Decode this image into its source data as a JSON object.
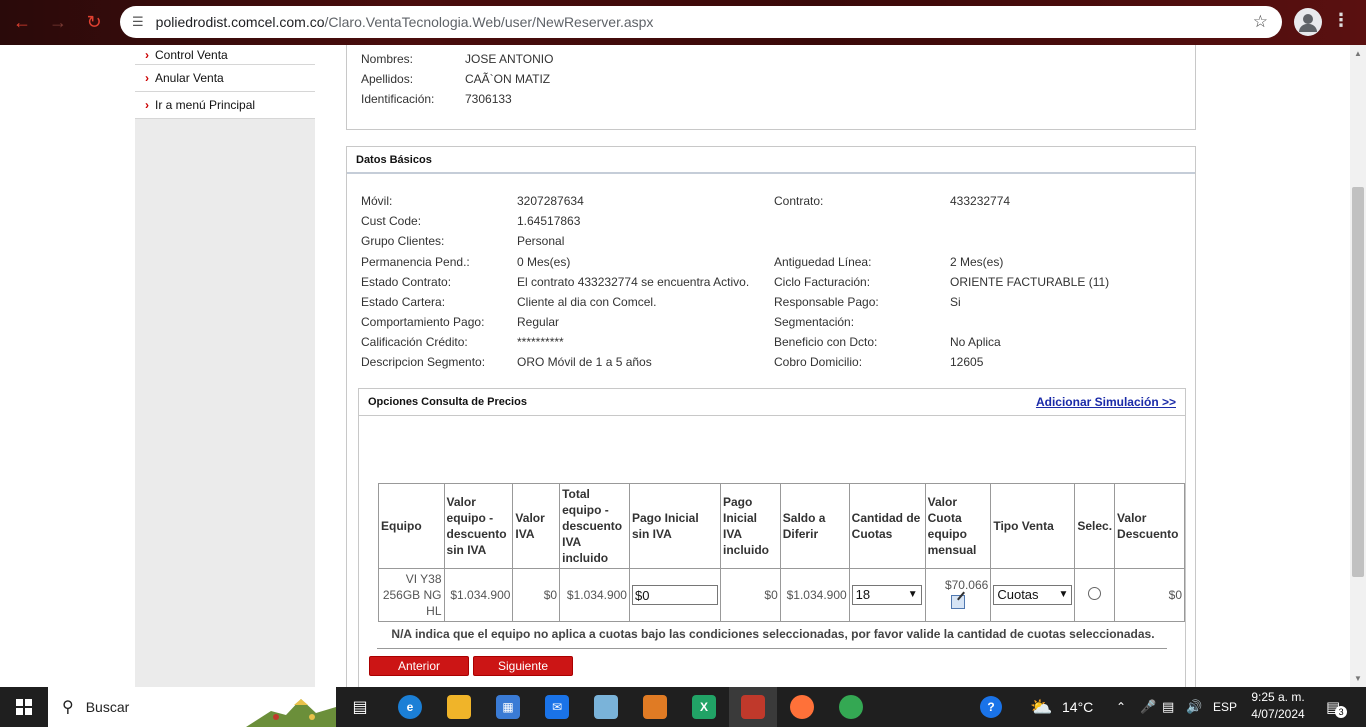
{
  "browser": {
    "url_host": "poliedrodist.comcel.com.co",
    "url_path": "/Claro.VentaTecnologia.Web/user/NewReserver.aspx"
  },
  "sidebar": {
    "items": [
      {
        "label": "Control Venta"
      },
      {
        "label": "Anular Venta"
      },
      {
        "label": "Ir a menú Principal"
      }
    ]
  },
  "client": {
    "nombres_label": "Nombres:",
    "nombres": "JOSE ANTONIO",
    "apellidos_label": "Apellidos:",
    "apellidos": "CAÃ`ON MATIZ",
    "identificacion_label": "Identificación:",
    "identificacion": "7306133"
  },
  "basic": {
    "title": "Datos Básicos",
    "left": [
      {
        "label": "Móvil:",
        "value": "3207287634"
      },
      {
        "label": "Cust Code:",
        "value": "1.64517863"
      },
      {
        "label": "Grupo Clientes:",
        "value": "Personal"
      },
      {
        "label": "Permanencia Pend.:",
        "value": "0 Mes(es)"
      },
      {
        "label": "Estado Contrato:",
        "value": "El contrato 433232774 se encuentra Activo."
      },
      {
        "label": "Estado Cartera:",
        "value": "Cliente al dia con Comcel."
      },
      {
        "label": "Comportamiento Pago:",
        "value": "Regular"
      },
      {
        "label": "Calificación Crédito:",
        "value": "**********"
      },
      {
        "label": "Descripcion Segmento:",
        "value": "ORO Móvil de 1 a 5 años"
      }
    ],
    "right": [
      {
        "label": "Contrato:",
        "value": "433232774"
      },
      {
        "label": "",
        "value": ""
      },
      {
        "label": "",
        "value": ""
      },
      {
        "label": "Antiguedad Línea:",
        "value": "2 Mes(es)"
      },
      {
        "label": "Ciclo Facturación:",
        "value": "ORIENTE FACTURABLE (11)"
      },
      {
        "label": "Responsable Pago:",
        "value": "Si"
      },
      {
        "label": "Segmentación:",
        "value": ""
      },
      {
        "label": "Beneficio con Dcto:",
        "value": "No Aplica"
      },
      {
        "label": "Cobro Domicilio:",
        "value": "12605"
      }
    ]
  },
  "options": {
    "title": "Opciones Consulta de Precios",
    "add_simulation": "Adicionar Simulación >>",
    "headers": {
      "equipo": "Equipo",
      "valor_equipo": "Valor equipo - descuento sin IVA",
      "valor_iva": "Valor IVA",
      "total_equipo": "Total equipo - descuento IVA incluido",
      "pago_inicial_sin_iva": "Pago Inicial sin IVA",
      "pago_inicial_iva": "Pago Inicial IVA incluido",
      "saldo_diferir": "Saldo a Diferir",
      "cantidad_cuotas": "Cantidad de Cuotas",
      "valor_cuota": "Valor Cuota equipo mensual",
      "tipo_venta": "Tipo Venta",
      "selec": "Selec.",
      "valor_descuento": "Valor Descuento"
    },
    "row": {
      "equipo": "VI Y38 256GB NG HL",
      "valor_equipo": "$1.034.900",
      "valor_iva": "$0",
      "total_equipo": "$1.034.900",
      "pago_inicial_sin_iva": "$0",
      "pago_inicial_iva": "$0",
      "saldo_diferir": "$1.034.900",
      "cantidad_cuotas": "18",
      "valor_cuota": "$70.066",
      "tipo_venta": "Cuotas",
      "valor_descuento": "$0"
    },
    "note": "N/A indica que el equipo no aplica a cuotas bajo las condiciones seleccionadas, por favor valide la cantidad de cuotas seleccionadas.",
    "anterior": "Anterior",
    "siguiente": "Siguiente"
  },
  "taskbar": {
    "search_placeholder": "Buscar",
    "weather": "14°C",
    "language": "ESP",
    "time": "9:25 a. m.",
    "date": "4/07/2024",
    "notifications": "3"
  }
}
